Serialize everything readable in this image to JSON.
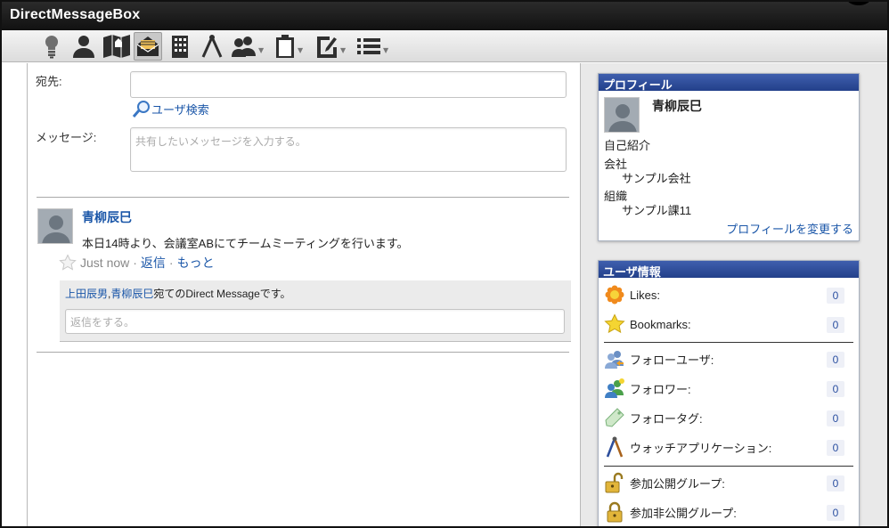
{
  "window": {
    "title": "DirectMessageBox"
  },
  "toolbar": {
    "icons": [
      "lightbulb-icon",
      "user-icon",
      "map-icon",
      "mail-icon",
      "building-icon",
      "compass-icon",
      "users-icon",
      "clipboard-icon",
      "edit-pin-icon",
      "list-icon"
    ]
  },
  "form": {
    "to_label": "宛先:",
    "to_value": "",
    "user_search_link": "ユーザ検索",
    "message_label": "メッセージ:",
    "message_placeholder": "共有したいメッセージを入力する。"
  },
  "post": {
    "author": "青柳辰巳",
    "body": "本日14時より、会議室ABにてチームミーティングを行います。",
    "time": "Just now",
    "separator": "·",
    "reply_link": "返信",
    "more_link": "もっと",
    "recipients": [
      "上田辰男",
      "青柳辰巳"
    ],
    "recipients_sep": ",",
    "recipients_suffix": "宛てのDirect Messageです。",
    "reply_placeholder": "返信をする。"
  },
  "profile_panel": {
    "title": "プロフィール",
    "name": "青柳辰巳",
    "intro_label": "自己紹介",
    "company_label": "会社",
    "company_value": "サンプル会社",
    "org_label": "組織",
    "org_value": "サンプル課11",
    "edit_link": "プロフィールを変更する"
  },
  "user_info_panel": {
    "title": "ユーザ情報",
    "rows": [
      {
        "label": "Likes:",
        "count": "0",
        "icon": "flower-icon"
      },
      {
        "label": "Bookmarks:",
        "count": "0",
        "icon": "star-icon"
      },
      {
        "label": "フォローユーザ:",
        "count": "0",
        "icon": "follow-user-icon"
      },
      {
        "label": "フォロワー:",
        "count": "0",
        "icon": "follower-icon"
      },
      {
        "label": "フォロータグ:",
        "count": "0",
        "icon": "tag-icon"
      },
      {
        "label": "ウォッチアプリケーション:",
        "count": "0",
        "icon": "compass-icon"
      },
      {
        "label": "参加公開グループ:",
        "count": "0",
        "icon": "open-lock-icon"
      },
      {
        "label": "参加非公開グループ:",
        "count": "0",
        "icon": "lock-icon"
      }
    ]
  }
}
